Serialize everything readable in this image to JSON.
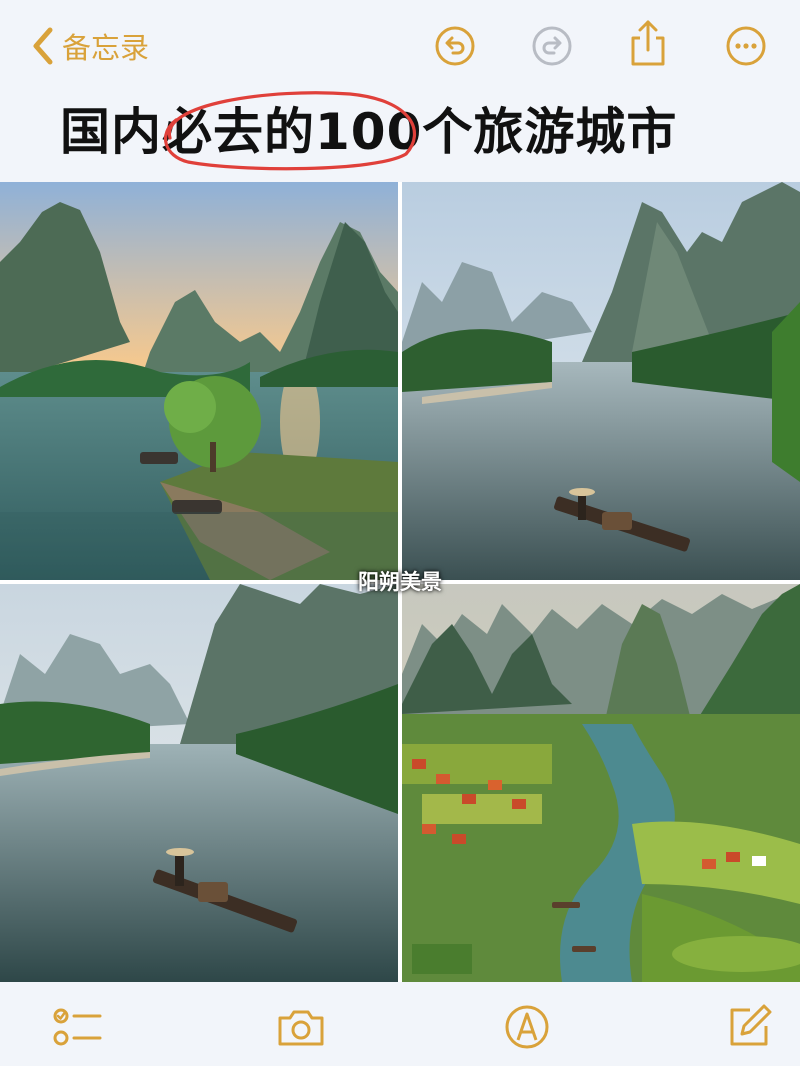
{
  "topbar": {
    "back_label": "备忘录",
    "icons": [
      "chevron-left-icon",
      "undo-icon",
      "redo-icon",
      "share-icon",
      "more-icon"
    ]
  },
  "note": {
    "title": "国内必去的100个旅游城市",
    "caption": "阳朔美景"
  },
  "bottombar": {
    "icons": [
      "checklist-icon",
      "camera-icon",
      "markup-pen-icon",
      "compose-icon"
    ]
  },
  "colors": {
    "accent": "#d9a23a",
    "disabled": "#b8bcc4",
    "circle_annotation": "#e0403a",
    "background": "#f2f5fa"
  }
}
